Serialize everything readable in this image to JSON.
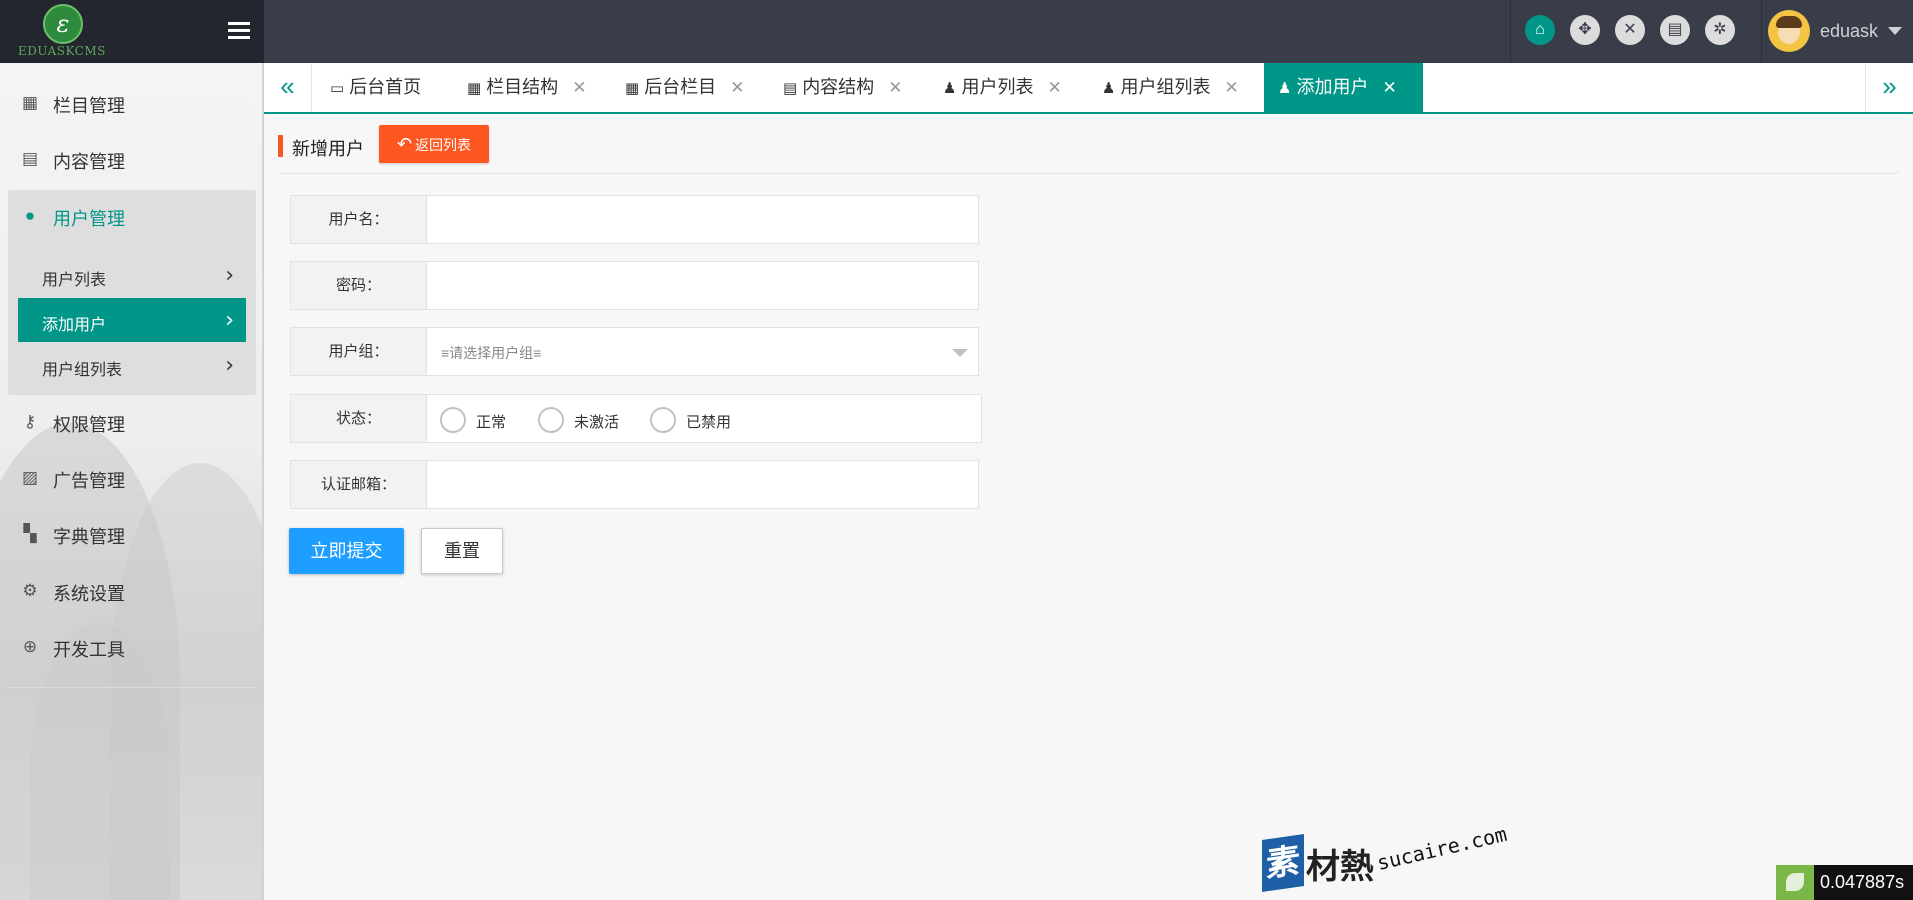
{
  "brand": {
    "logo_glyph": "ɛ",
    "logo_text": "EDUASKCMS"
  },
  "header": {
    "tools": [
      {
        "icon": "home-icon",
        "glyph": "⌂"
      },
      {
        "icon": "move-icon",
        "glyph": "✥"
      },
      {
        "icon": "close-icon",
        "glyph": "✕"
      },
      {
        "icon": "book-icon",
        "glyph": "▤"
      },
      {
        "icon": "settings-icon",
        "glyph": "✲"
      }
    ],
    "username": "eduask"
  },
  "sidebar": {
    "items": [
      {
        "label": "栏目管理",
        "icon": "grid-icon",
        "glyph": "▦"
      },
      {
        "label": "内容管理",
        "icon": "file-icon",
        "glyph": "▤"
      },
      {
        "label": "用户管理",
        "icon": "user-icon",
        "glyph": "●"
      },
      {
        "label": "权限管理",
        "icon": "key-icon",
        "glyph": "⚷"
      },
      {
        "label": "广告管理",
        "icon": "image-icon",
        "glyph": "▨"
      },
      {
        "label": "字典管理",
        "icon": "th-large-icon",
        "glyph": "▚"
      },
      {
        "label": "系统设置",
        "icon": "gears-icon",
        "glyph": "⚙"
      },
      {
        "label": "开发工具",
        "icon": "search-plus-icon",
        "glyph": "⊕"
      }
    ],
    "sub_items": [
      {
        "label": "用户列表",
        "chevron": "›"
      },
      {
        "label": "添加用户",
        "chevron": "›"
      },
      {
        "label": "用户组列表",
        "chevron": "›"
      }
    ]
  },
  "tabs": {
    "left_arrow": "«",
    "right_arrow": "»",
    "close_glyph": "✕",
    "items": [
      {
        "label": "后台首页",
        "icon": "desktop-icon",
        "glyph": "▭"
      },
      {
        "label": "栏目结构",
        "icon": "grid-icon",
        "glyph": "▦"
      },
      {
        "label": "后台栏目",
        "icon": "grid-icon",
        "glyph": "▦"
      },
      {
        "label": "内容结构",
        "icon": "file-icon",
        "glyph": "▤"
      },
      {
        "label": "用户列表",
        "icon": "user-icon",
        "glyph": "♟"
      },
      {
        "label": "用户组列表",
        "icon": "user-icon",
        "glyph": "♟"
      },
      {
        "label": "添加用户",
        "icon": "user-icon",
        "glyph": "♟"
      }
    ]
  },
  "page": {
    "title": "新增用户",
    "back_button": "返回列表",
    "back_glyph": "↶"
  },
  "form": {
    "username_label": "用户名：",
    "username_value": "",
    "password_label": "密码：",
    "password_value": "",
    "group_label": "用户组：",
    "group_placeholder": "≡请选择用户组≡",
    "status_label": "状态：",
    "status_options": [
      "正常",
      "未激活",
      "已禁用"
    ],
    "email_label": "认证邮箱：",
    "email_value": "",
    "submit": "立即提交",
    "reset": "重置"
  },
  "watermark": {
    "box": "素",
    "zh": "材熱",
    "en": "sucaire.com"
  },
  "timer": "0.047887s",
  "colors": {
    "accent": "#009688",
    "header": "#393d49",
    "danger": "#ff5722",
    "primary": "#1e9fff"
  }
}
